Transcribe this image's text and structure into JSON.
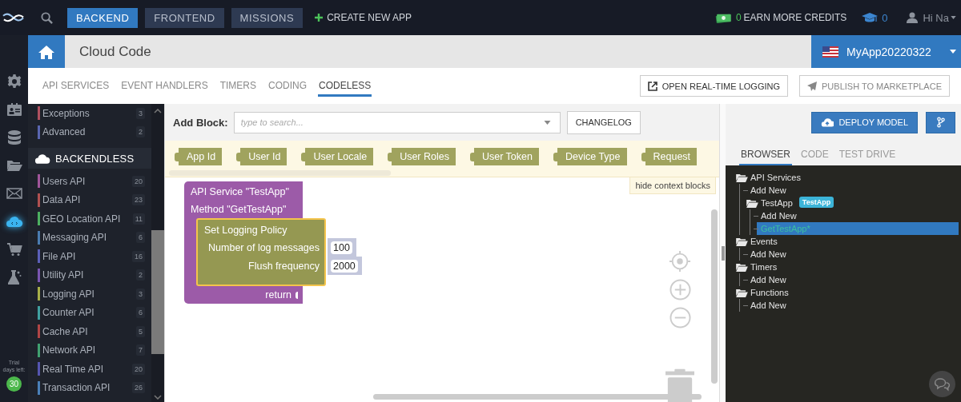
{
  "topbar": {
    "nav": [
      {
        "label": "BACKEND",
        "selected": true
      },
      {
        "label": "FRONTEND",
        "selected": false
      },
      {
        "label": "MISSIONS",
        "selected": false
      }
    ],
    "create": "CREATE NEW APP",
    "credits": "0",
    "credits_label": "EARN MORE CREDITS",
    "courses": "0",
    "user": "Hi Na"
  },
  "rail": {
    "items": [
      {
        "kind": "gear",
        "selected": false
      },
      {
        "kind": "card",
        "selected": false
      },
      {
        "kind": "database",
        "selected": false
      },
      {
        "kind": "folder",
        "selected": false
      },
      {
        "kind": "mail",
        "selected": false
      },
      {
        "kind": "cloud",
        "selected": true
      },
      {
        "kind": "cart",
        "selected": false
      },
      {
        "kind": "flask",
        "selected": false
      }
    ],
    "trial_label": "Trial days left:",
    "trial_days": "30"
  },
  "header": {
    "title": "Cloud Code",
    "app": "MyApp20220322"
  },
  "tabs": [
    {
      "label": "API SERVICES",
      "selected": false
    },
    {
      "label": "EVENT HANDLERS",
      "selected": false
    },
    {
      "label": "TIMERS",
      "selected": false
    },
    {
      "label": "CODING",
      "selected": false
    },
    {
      "label": "CODELESS",
      "selected": true
    }
  ],
  "actions": [
    {
      "kind": "logging",
      "label": "OPEN REAL-TIME LOGGING",
      "disabled": false
    },
    {
      "kind": "publish",
      "label": "PUBLISH TO MARKETPLACE",
      "disabled": true
    }
  ],
  "sidebar": {
    "top_items": [
      {
        "name": "Exceptions",
        "count": "3",
        "color": "#b0505f"
      },
      {
        "name": "Advanced",
        "count": "2",
        "color": "#5a66b0"
      }
    ],
    "section": "BACKENDLESS",
    "items": [
      {
        "name": "Users API",
        "count": "20",
        "color": "#a0559a"
      },
      {
        "name": "Data API",
        "count": "23",
        "color": "#b05050"
      },
      {
        "name": "GEO Location API",
        "count": "11",
        "color": "#4caf60"
      },
      {
        "name": "Messaging API",
        "count": "6",
        "color": "#4a7cb0"
      },
      {
        "name": "File API",
        "count": "16",
        "color": "#5b5fb8"
      },
      {
        "name": "Utility API",
        "count": "2",
        "color": "#7a55b0"
      },
      {
        "name": "Logging API",
        "count": "3",
        "color": "#a8b048"
      },
      {
        "name": "Counter API",
        "count": "6",
        "color": "#40a0a0"
      },
      {
        "name": "Cache API",
        "count": "5",
        "color": "#b04545"
      },
      {
        "name": "Network API",
        "count": "7",
        "color": "#40a070"
      },
      {
        "name": "Real Time API",
        "count": "20",
        "color": "#5555b0"
      },
      {
        "name": "Transaction API",
        "count": "26",
        "color": "#4a80b8"
      }
    ]
  },
  "editor": {
    "add_block_label": "Add Block:",
    "search_placeholder": "type to search...",
    "changelog": "CHANGELOG",
    "context_blocks": [
      "App Id",
      "User Id",
      "User Locale",
      "User Roles",
      "User Token",
      "Device Type",
      "Request"
    ],
    "hide_context": "hide context blocks",
    "service_block": {
      "lines": [
        "API Service \"TestApp\"",
        "Method \"GetTestApp\""
      ],
      "inner": {
        "title": "Set Logging Policy",
        "params": [
          {
            "label": "Number of log messages",
            "value": "100"
          },
          {
            "label": "Flush frequency",
            "value": "2000"
          }
        ]
      },
      "return": "return"
    }
  },
  "right": {
    "deploy": "DEPLOY MODEL",
    "tabs": [
      {
        "label": "BROWSER",
        "selected": true
      },
      {
        "label": "CODE",
        "selected": false
      },
      {
        "label": "TEST DRIVE",
        "selected": false
      }
    ],
    "tree": [
      {
        "kind": "folder",
        "label": "API Services",
        "selected": false,
        "children": [
          {
            "kind": "leaf",
            "label": "Add New",
            "selected": false
          },
          {
            "kind": "folder",
            "label": "TestApp",
            "badge": "TestApp",
            "selected": false,
            "children": [
              {
                "kind": "leaf",
                "label": "Add New",
                "selected": false
              },
              {
                "kind": "leaf",
                "label": "GetTestApp*",
                "selected": true
              }
            ]
          }
        ]
      },
      {
        "kind": "folder",
        "label": "Events",
        "selected": false,
        "children": [
          {
            "kind": "leaf",
            "label": "Add New",
            "selected": false
          }
        ]
      },
      {
        "kind": "folder",
        "label": "Timers",
        "selected": false,
        "children": [
          {
            "kind": "leaf",
            "label": "Add New",
            "selected": false
          }
        ]
      },
      {
        "kind": "folder",
        "label": "Functions",
        "selected": false,
        "children": [
          {
            "kind": "leaf",
            "label": "Add New",
            "selected": false
          }
        ]
      }
    ]
  }
}
